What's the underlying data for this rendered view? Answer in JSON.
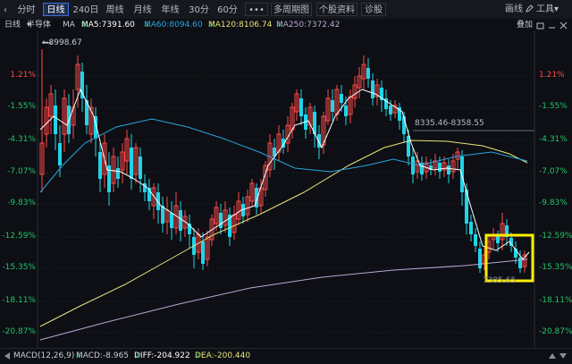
{
  "toolbar": {
    "tabs": [
      {
        "label": "分时",
        "active": false
      },
      {
        "label": "日线",
        "active": true
      },
      {
        "label": "240日",
        "active": false
      },
      {
        "label": "周线",
        "active": false
      },
      {
        "label": "月线",
        "active": false
      },
      {
        "label": "年线",
        "active": false
      },
      {
        "label": "30分",
        "active": false
      },
      {
        "label": "60分",
        "active": false
      },
      {
        "label": "•••",
        "active": false
      },
      {
        "label": "多周期图",
        "active": false
      },
      {
        "label": "个股资料",
        "active": false
      },
      {
        "label": "诊股",
        "active": false
      }
    ],
    "draw_label": "画线",
    "tools_label": "工具",
    "dropdown_arrow": "▾"
  },
  "ma_row": {
    "period": "日线",
    "name": "半导体",
    "name_arrow": "▾",
    "ma_label": "MA",
    "ma5": "MA5:7391.60",
    "ma5_dir": "↓",
    "ma60": "MA60:8094.60",
    "ma60_dir": "↓",
    "ma120": "MA120:8106.74",
    "ma120_dir": "↓",
    "ma250": "MA250:7372.42",
    "ma250_dir": "↓",
    "overlay": "叠加"
  },
  "y_axis": {
    "left": [
      "1.21%",
      "-1.55%",
      "-4.31%",
      "-7.07%",
      "-9.83%",
      "-12.59%",
      "-15.35%",
      "-18.11%",
      "-20.87%"
    ],
    "right": [
      "1.21%",
      "-1.55%",
      "-4.31%",
      "-7.07%",
      "-9.83%",
      "-12.59%",
      "-15.35%",
      "-18.11%",
      "-20.87%"
    ]
  },
  "annotations": {
    "high_mark": "8998.67",
    "range_mark": "8335.46-8358.55",
    "low_mark": "7385.65"
  },
  "macd": {
    "name": "MACD(12,26,9)",
    "macd": "MACD:-8.965",
    "macd_dir": "↓",
    "diff": "DIFF:-204.922",
    "diff_dir": "↓",
    "dea": "DEA:-200.440",
    "dea_dir": "↓"
  },
  "colors": {
    "up": "#ff4a4a",
    "down": "#1fd4e8",
    "ma5": "#ffffff",
    "ma60": "#2aa3e0",
    "ma120": "#e8e27a",
    "ma250": "#b9a6d6",
    "highlight": "#ffee00",
    "axis_pct_pos": "#ff4a4a",
    "axis_pct_neg": "#21c46a"
  }
}
